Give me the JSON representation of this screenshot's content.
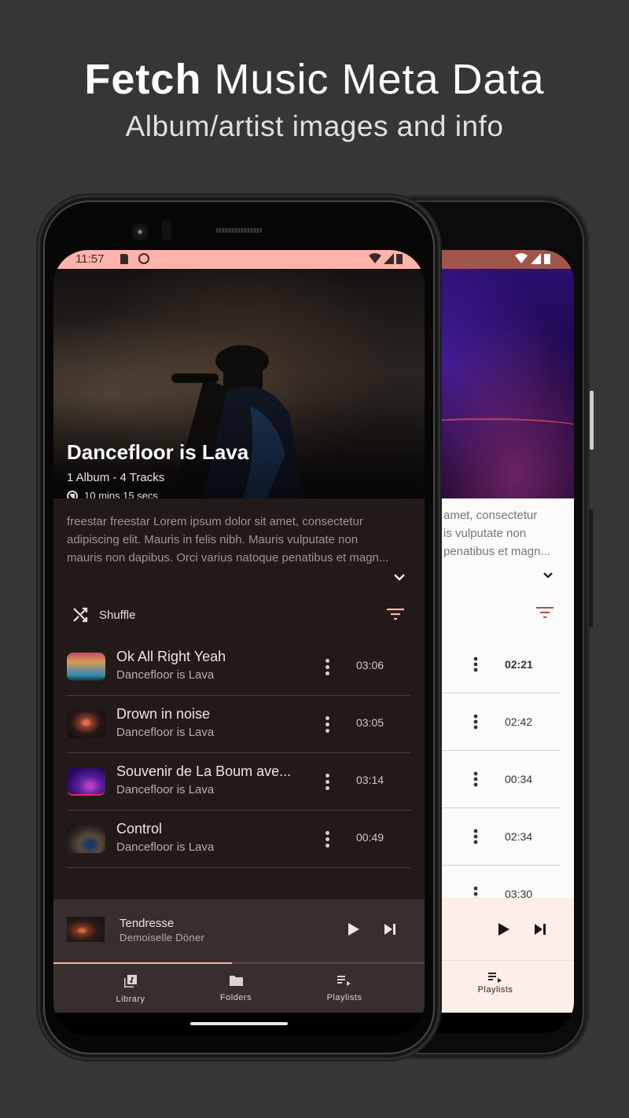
{
  "promo": {
    "headline_bold": "Fetch",
    "headline_rest": " Music Meta Data",
    "subline": "Album/artist images and info"
  },
  "status_bar": {
    "time": "11:57",
    "icons": [
      "sd-card-icon",
      "notification-face-icon",
      "wifi-icon",
      "signal-icon",
      "battery-icon"
    ]
  },
  "artist": {
    "name": "Dancefloor is Lava",
    "meta": "1 Album - 4 Tracks",
    "duration": "10 mins 15 secs",
    "description_lines": [
      "freestar freestar Lorem ipsum dolor sit amet, consectetur",
      "adipiscing elit. Mauris in felis nibh. Mauris vulputate non",
      "mauris non dapibus. Orci varius natoque penatibus et magn..."
    ]
  },
  "actions": {
    "shuffle_label": "Shuffle"
  },
  "tracks": [
    {
      "title": "Ok All Right Yeah",
      "artist": "Dancefloor is Lava",
      "duration": "03:06"
    },
    {
      "title": "Drown in noise",
      "artist": "Dancefloor is Lava",
      "duration": "03:05"
    },
    {
      "title": "Souvenir de La Boum ave...",
      "artist": "Dancefloor is Lava",
      "duration": "03:14"
    },
    {
      "title": "Control",
      "artist": "Dancefloor is Lava",
      "duration": "00:49"
    }
  ],
  "now_playing": {
    "title": "Tendresse",
    "artist": "Demoiselle Döner",
    "progress_percent": 48
  },
  "bottom_nav": [
    {
      "label": "Library",
      "icon": "library-music-icon"
    },
    {
      "label": "Folders",
      "icon": "folder-icon"
    },
    {
      "label": "Playlists",
      "icon": "playlist-play-icon"
    }
  ],
  "back_phone": {
    "description_lines": [
      "amet, consectetur",
      "is vulputate non",
      "penatibus et magn..."
    ],
    "durations": [
      "02:21",
      "02:42",
      "00:34",
      "02:34",
      "03:30"
    ],
    "nav_label": "Playlists"
  },
  "colors": {
    "accent": "#ffb4ab",
    "accent_dark": "#a0554a",
    "background": "#211a19",
    "surface": "#382e2d",
    "page_background": "#363636"
  }
}
